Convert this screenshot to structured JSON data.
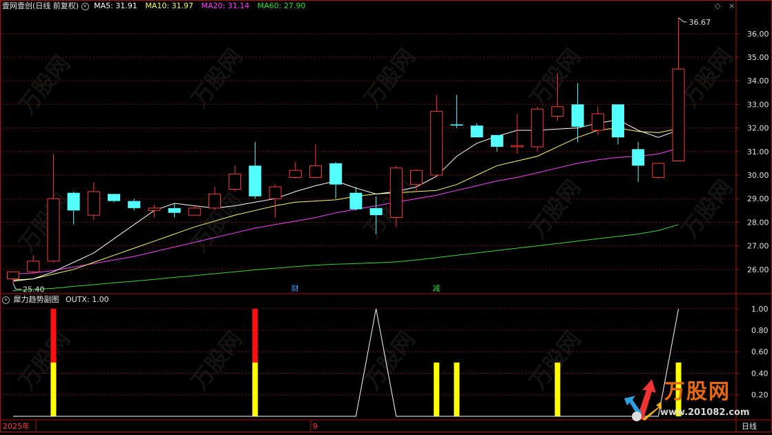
{
  "header": {
    "title": "壹网壹创(日线 前复权)",
    "ma5": "MA5: 31.91",
    "ma10": "MA10: 31.97",
    "ma20": "MA20: 31.14",
    "ma60": "MA60: 27.90"
  },
  "sub_header": {
    "title": "犀力趋势副图",
    "outx": "OUTX: 1.00"
  },
  "annotations": {
    "high_label": "36.67",
    "low_label": "25.40",
    "marker_cai": "财",
    "marker_jian": "减",
    "date_left": "2025年",
    "date_mid": "9",
    "period": "日线"
  },
  "watermark": {
    "brand": "万股网",
    "url": "www.201082.com"
  },
  "colors": {
    "up": "#ff3b3b",
    "down": "#54ffff",
    "ma5": "#ffffff",
    "ma10": "#ffff66",
    "ma20": "#ff40ff",
    "ma60": "#33dd33",
    "axis": "#b01010",
    "bar_yellow": "#ffff00",
    "bar_red": "#ff1010"
  },
  "chart_data": [
    {
      "type": "candlestick",
      "y_ticks": [
        26,
        27,
        28,
        29,
        30,
        31,
        32,
        33,
        34,
        35,
        36
      ],
      "y_tick_labels": [
        "26.00",
        "27.00",
        "28.00",
        "29.00",
        "30.00",
        "31.00",
        "32.00",
        "33.00",
        "34.00",
        "35.00",
        "36.00"
      ],
      "ylim": [
        25.0,
        36.9
      ],
      "candles": [
        {
          "o": 25.6,
          "c": 25.9,
          "h": 25.9,
          "l": 25.4
        },
        {
          "o": 25.9,
          "c": 26.35,
          "h": 26.6,
          "l": 25.8
        },
        {
          "o": 26.35,
          "c": 29.0,
          "h": 30.9,
          "l": 26.3
        },
        {
          "o": 29.25,
          "c": 28.5,
          "h": 29.3,
          "l": 27.9
        },
        {
          "o": 28.3,
          "c": 29.3,
          "h": 29.7,
          "l": 28.1
        },
        {
          "o": 29.2,
          "c": 28.9,
          "h": 29.2,
          "l": 28.85
        },
        {
          "o": 28.9,
          "c": 28.6,
          "h": 29.0,
          "l": 28.5
        },
        {
          "o": 28.5,
          "c": 28.6,
          "h": 28.75,
          "l": 28.2
        },
        {
          "o": 28.6,
          "c": 28.4,
          "h": 28.8,
          "l": 28.2
        },
        {
          "o": 28.3,
          "c": 28.6,
          "h": 28.7,
          "l": 28.3
        },
        {
          "o": 28.6,
          "c": 29.2,
          "h": 29.5,
          "l": 28.5
        },
        {
          "o": 29.4,
          "c": 30.05,
          "h": 30.4,
          "l": 29.3
        },
        {
          "o": 30.4,
          "c": 29.1,
          "h": 31.4,
          "l": 29.0
        },
        {
          "o": 29.0,
          "c": 29.5,
          "h": 29.6,
          "l": 28.2
        },
        {
          "o": 29.9,
          "c": 30.2,
          "h": 30.55,
          "l": 29.85
        },
        {
          "o": 29.9,
          "c": 30.4,
          "h": 31.3,
          "l": 29.85
        },
        {
          "o": 30.5,
          "c": 29.6,
          "h": 30.55,
          "l": 29.0
        },
        {
          "o": 29.25,
          "c": 28.55,
          "h": 29.5,
          "l": 28.5
        },
        {
          "o": 28.6,
          "c": 28.3,
          "h": 29.1,
          "l": 27.5
        },
        {
          "o": 28.2,
          "c": 30.3,
          "h": 30.4,
          "l": 27.8
        },
        {
          "o": 29.6,
          "c": 30.2,
          "h": 30.25,
          "l": 29.3
        },
        {
          "o": 30.0,
          "c": 32.7,
          "h": 33.4,
          "l": 29.9
        },
        {
          "o": 32.15,
          "c": 32.1,
          "h": 33.4,
          "l": 32.0
        },
        {
          "o": 32.1,
          "c": 31.6,
          "h": 32.2,
          "l": 31.6
        },
        {
          "o": 31.7,
          "c": 31.2,
          "h": 31.7,
          "l": 31.0
        },
        {
          "o": 31.2,
          "c": 31.25,
          "h": 32.6,
          "l": 30.9
        },
        {
          "o": 31.2,
          "c": 32.8,
          "h": 32.9,
          "l": 31.0
        },
        {
          "o": 32.5,
          "c": 32.9,
          "h": 34.3,
          "l": 32.3
        },
        {
          "o": 33.0,
          "c": 32.05,
          "h": 33.9,
          "l": 31.4
        },
        {
          "o": 31.9,
          "c": 32.6,
          "h": 32.9,
          "l": 31.7
        },
        {
          "o": 33.0,
          "c": 31.6,
          "h": 33.0,
          "l": 31.3
        },
        {
          "o": 31.1,
          "c": 30.4,
          "h": 31.4,
          "l": 29.7
        },
        {
          "o": 29.9,
          "c": 30.5,
          "h": 30.5,
          "l": 29.85
        },
        {
          "o": 30.6,
          "c": 34.5,
          "h": 36.67,
          "l": 30.6
        }
      ],
      "ma5": [
        25.5,
        25.6,
        25.9,
        26.3,
        26.7,
        27.3,
        27.9,
        28.5,
        28.8,
        28.7,
        28.6,
        28.7,
        28.85,
        29.0,
        29.3,
        29.55,
        29.75,
        29.45,
        29.2,
        29.3,
        29.5,
        29.95,
        30.8,
        31.35,
        31.65,
        31.9,
        31.9,
        31.95,
        32.0,
        32.2,
        32.35,
        31.9,
        31.6,
        31.91
      ],
      "ma10": [
        25.55,
        25.6,
        25.8,
        26.0,
        26.3,
        26.6,
        26.9,
        27.2,
        27.5,
        27.8,
        28.05,
        28.3,
        28.5,
        28.7,
        28.85,
        28.9,
        28.95,
        29.1,
        29.2,
        29.25,
        29.3,
        29.35,
        29.6,
        30.0,
        30.4,
        30.6,
        30.8,
        31.2,
        31.6,
        31.9,
        32.0,
        31.85,
        31.8,
        31.97
      ],
      "ma20": [
        25.8,
        25.85,
        25.95,
        26.1,
        26.25,
        26.4,
        26.55,
        26.75,
        26.95,
        27.15,
        27.35,
        27.55,
        27.75,
        27.9,
        28.05,
        28.2,
        28.4,
        28.55,
        28.7,
        28.85,
        29.0,
        29.15,
        29.35,
        29.55,
        29.75,
        29.9,
        30.1,
        30.3,
        30.5,
        30.65,
        30.75,
        30.8,
        30.9,
        31.14
      ],
      "ma60": [
        25.1,
        25.15,
        25.2,
        25.28,
        25.35,
        25.43,
        25.5,
        25.58,
        25.66,
        25.74,
        25.82,
        25.9,
        25.98,
        26.05,
        26.12,
        26.18,
        26.22,
        26.25,
        26.28,
        26.32,
        26.4,
        26.5,
        26.6,
        26.7,
        26.8,
        26.9,
        27.0,
        27.1,
        27.2,
        27.3,
        27.4,
        27.5,
        27.65,
        27.9
      ]
    },
    {
      "type": "bar",
      "y_ticks": [
        0.2,
        0.4,
        0.6,
        0.8,
        1.0
      ],
      "y_tick_labels": [
        "0.20",
        "0.40",
        "0.60",
        "0.80",
        "1.00"
      ],
      "ylim": [
        -0.02,
        1.05
      ],
      "red_bars": [
        0,
        0,
        1,
        0,
        0,
        0,
        0,
        0,
        0,
        0,
        0,
        0,
        1,
        0,
        0,
        0,
        0,
        0,
        0,
        0,
        0,
        0,
        0,
        0,
        0,
        0,
        0,
        0,
        0,
        0,
        0,
        0,
        0,
        0
      ],
      "yellow_bars": [
        0,
        0,
        0.5,
        0,
        0,
        0,
        0,
        0,
        0,
        0,
        0,
        0,
        0.5,
        0,
        0,
        0,
        0,
        0,
        0,
        0,
        0,
        0.5,
        0.5,
        0,
        0,
        0,
        0,
        0.5,
        0,
        0,
        0,
        0,
        0,
        0.5
      ],
      "outx": [
        0,
        0,
        0,
        0,
        0,
        0,
        0,
        0,
        0,
        0,
        0,
        0,
        0,
        0,
        0,
        0,
        0,
        0,
        1,
        0,
        0,
        0,
        0,
        0,
        0,
        0,
        0,
        0,
        0,
        0,
        0,
        0,
        0,
        1
      ]
    }
  ]
}
